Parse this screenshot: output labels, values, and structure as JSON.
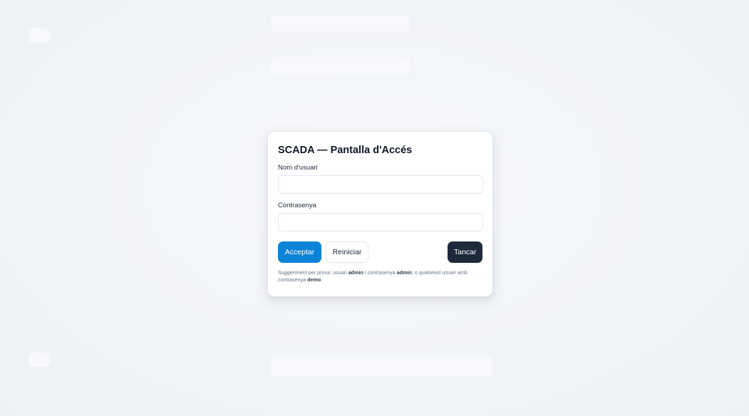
{
  "dialog": {
    "title": "SCADA — Pantalla d'Accés",
    "username": {
      "label": "Nom d'usuari",
      "value": "",
      "placeholder": ""
    },
    "password": {
      "label": "Contrasenya",
      "value": "",
      "placeholder": ""
    },
    "buttons": {
      "accept": "Acceptar",
      "reset": "Reiniciar",
      "close": "Tancar"
    },
    "hint": {
      "part1": "Suggeriment per prova: usuari ",
      "user": "admin",
      "part2": " i contrasenya ",
      "pass": "admin",
      "part3": "; o qualsevol usuari amb contrasenya ",
      "demo": "demo",
      "part4": "."
    }
  },
  "colors": {
    "background": "#f1f5f9",
    "accept": "#0b84d8",
    "close": "#1e293b",
    "card": "#ffffff"
  }
}
